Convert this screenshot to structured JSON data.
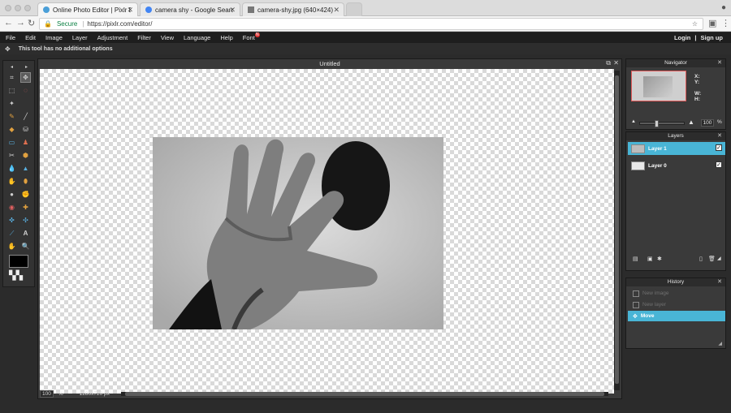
{
  "browser": {
    "tabs": [
      {
        "title": "Online Photo Editor | Pixlr Editor",
        "active": true
      },
      {
        "title": "camera shy - Google Search",
        "active": false
      },
      {
        "title": "camera-shy.jpg (640×424)",
        "active": false
      }
    ],
    "secure_label": "Secure",
    "url": "https://pixlr.com/editor/"
  },
  "menu": {
    "items": [
      "File",
      "Edit",
      "Image",
      "Layer",
      "Adjustment",
      "Filter",
      "View",
      "Language",
      "Help",
      "Font"
    ],
    "font_badge": "N",
    "login": "Login",
    "separator": "|",
    "signup": "Sign up"
  },
  "options_bar": {
    "text": "This tool has no additional options"
  },
  "document": {
    "title": "Untitled",
    "zoom": "100",
    "zoom_unit": "%",
    "size": "1280x720 px"
  },
  "navigator": {
    "title": "Navigator",
    "x_label": "X:",
    "y_label": "Y:",
    "w_label": "W:",
    "h_label": "H:",
    "zoom": "100",
    "zoom_unit": "%"
  },
  "layers": {
    "title": "Layers",
    "items": [
      {
        "name": "Layer 1",
        "active": true
      },
      {
        "name": "Layer 0",
        "active": false
      }
    ]
  },
  "history": {
    "title": "History",
    "items": [
      {
        "name": "New image",
        "active": false
      },
      {
        "name": "New layer",
        "active": false
      },
      {
        "name": "Move",
        "active": true
      }
    ]
  },
  "colors": {
    "accent": "#49b5d6",
    "panel_bg": "#3a3a3a",
    "menubar": "#1e1e1e"
  }
}
